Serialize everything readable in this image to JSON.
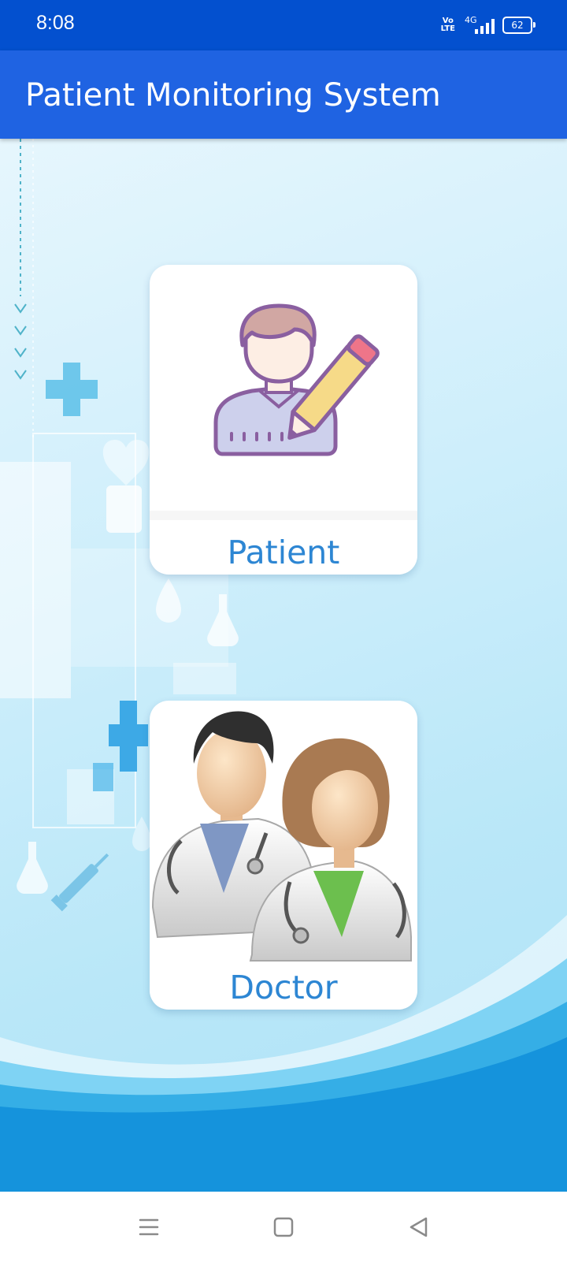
{
  "status_bar": {
    "time": "8:08",
    "volte_line1": "Vo",
    "volte_line2": "LTE",
    "network": "4G",
    "battery": "62"
  },
  "app_bar": {
    "title": "Patient Monitoring System",
    "color": "#1f63e2"
  },
  "cards": {
    "patient": {
      "label": "Patient",
      "icon": "patient-edit-icon"
    },
    "doctor": {
      "label": "Doctor",
      "icon": "doctors-icon"
    }
  },
  "nav_bar": {
    "menu_icon": "menu-icon",
    "home_icon": "home-icon",
    "back_icon": "back-icon"
  },
  "colors": {
    "status_bar": "#0350cf",
    "label": "#2d86d3",
    "wave": "#1593dc"
  }
}
